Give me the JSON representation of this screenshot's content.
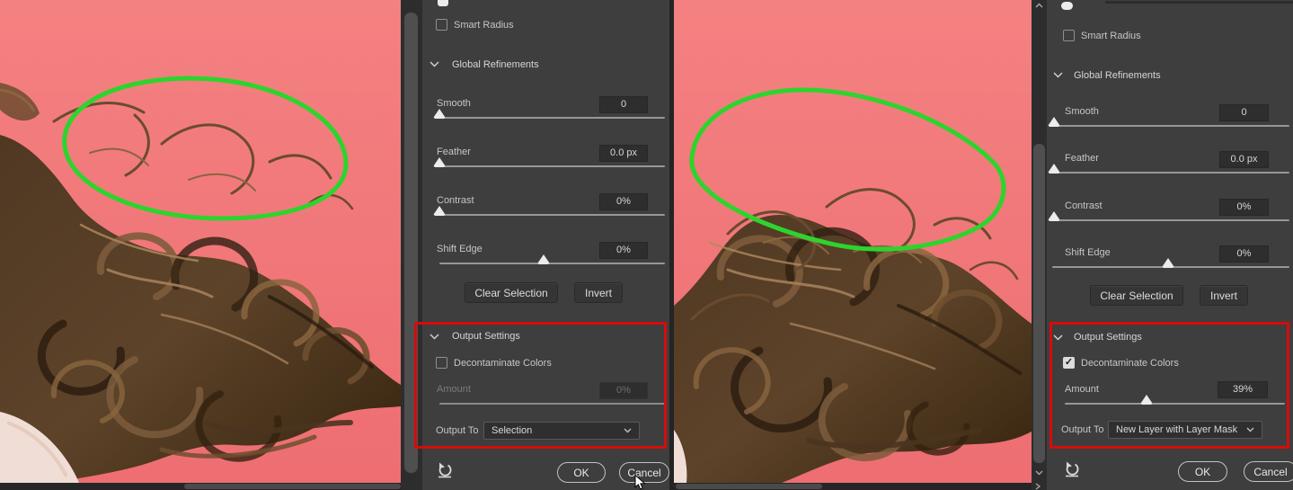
{
  "colors": {
    "canvas_background": "#f17676",
    "annotation_circle": "#2dd42d",
    "annotation_box": "#d70b0b",
    "panel_background": "#3e3e3e"
  },
  "icons": {
    "checkmark": "✓"
  },
  "left_panel": {
    "smart_radius": {
      "label": "Smart Radius",
      "checked": false
    },
    "global_refinements_label": "Global Refinements",
    "sliders": [
      {
        "label": "Smooth",
        "value": "0"
      },
      {
        "label": "Feather",
        "value": "0.0 px"
      },
      {
        "label": "Contrast",
        "value": "0%"
      },
      {
        "label": "Shift Edge",
        "value": "0%"
      }
    ],
    "clear_selection_label": "Clear Selection",
    "invert_label": "Invert",
    "output_settings_label": "Output Settings",
    "decontaminate": {
      "label": "Decontaminate Colors",
      "checked": false
    },
    "amount": {
      "label": "Amount",
      "value": "0%",
      "disabled": true
    },
    "output_to": {
      "label": "Output To",
      "value": "Selection"
    },
    "ok_label": "OK",
    "cancel_label": "Cancel"
  },
  "right_panel": {
    "smart_radius": {
      "label": "Smart Radius",
      "checked": false
    },
    "global_refinements_label": "Global Refinements",
    "sliders": [
      {
        "label": "Smooth",
        "value": "0"
      },
      {
        "label": "Feather",
        "value": "0.0 px"
      },
      {
        "label": "Contrast",
        "value": "0%"
      },
      {
        "label": "Shift Edge",
        "value": "0%"
      }
    ],
    "clear_selection_label": "Clear Selection",
    "invert_label": "Invert",
    "output_settings_label": "Output Settings",
    "decontaminate": {
      "label": "Decontaminate Colors",
      "checked": true
    },
    "amount": {
      "label": "Amount",
      "value": "39%",
      "disabled": false
    },
    "output_to": {
      "label": "Output To",
      "value": "New Layer with Layer Mask"
    },
    "ok_label": "OK",
    "cancel_label": "Cancel"
  }
}
